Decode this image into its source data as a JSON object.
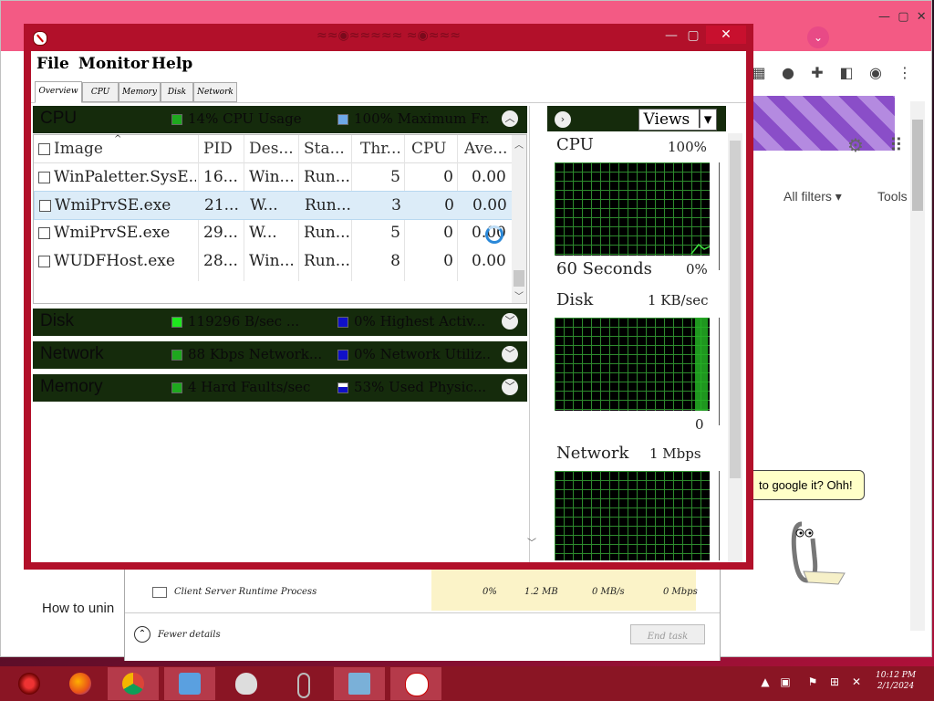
{
  "chrome": {
    "all_filters": "All filters",
    "tools": "Tools",
    "tooltip": "to google it? Ohh!",
    "left_howto": "How to unin"
  },
  "resmon": {
    "menu": [
      "File",
      "Monitor",
      "Help"
    ],
    "tabs": [
      "Overview",
      "CPU",
      "Memory",
      "Disk",
      "Network"
    ],
    "cpu_section": {
      "title": "CPU",
      "usage": "14% CPU Usage",
      "max_freq": "100% Maximum Fr..."
    },
    "table": {
      "columns": [
        "Image",
        "PID",
        "Des...",
        "Sta...",
        "Thr...",
        "CPU",
        "Ave..."
      ],
      "rows": [
        {
          "image": "WinPaletter.SysE...",
          "pid": "16...",
          "desc": "Win...",
          "status": "Run...",
          "threads": "5",
          "cpu": "0",
          "avg": "0.00"
        },
        {
          "image": "WmiPrvSE.exe",
          "pid": "21...",
          "desc": "W...",
          "status": "Run...",
          "threads": "3",
          "cpu": "0",
          "avg": "0.00"
        },
        {
          "image": "WmiPrvSE.exe",
          "pid": "29...",
          "desc": "W...",
          "status": "Run...",
          "threads": "5",
          "cpu": "0",
          "avg": "0.00"
        },
        {
          "image": "WUDFHost.exe",
          "pid": "28...",
          "desc": "Win...",
          "status": "Run...",
          "threads": "8",
          "cpu": "0",
          "avg": "0.00"
        }
      ]
    },
    "disk_section": {
      "title": "Disk",
      "stat1": "119296 B/sec ...",
      "stat2": "0% Highest Activ..."
    },
    "network_section": {
      "title": "Network",
      "stat1": "88 Kbps Network...",
      "stat2": "0% Network Utiliz..."
    },
    "memory_section": {
      "title": "Memory",
      "stat1": "4 Hard Faults/sec",
      "stat2": "53% Used Physic..."
    },
    "views_label": "Views",
    "graphs": {
      "cpu": {
        "title": "CPU",
        "max": "100%",
        "time": "60 Seconds",
        "min": "0%"
      },
      "disk": {
        "title": "Disk",
        "max": "1 KB/sec",
        "min": "0"
      },
      "network": {
        "title": "Network",
        "max": "1 Mbps"
      }
    }
  },
  "taskmgr": {
    "process_name": "Client Server Runtime Process",
    "cpu": "0%",
    "mem": "1.2 MB",
    "disk": "0 MB/s",
    "net": "0 Mbps",
    "fewer_details": "Fewer details",
    "end_task": "End task"
  },
  "taskbar": {
    "time": "10:12 PM",
    "date": "2/1/2024"
  },
  "colors": {
    "window_frame": "#b2102a",
    "section_bar": "#152b0c",
    "graph_bg": "#000000",
    "graph_grid": "#2d8a2d",
    "taskbar": "#8a1524"
  }
}
